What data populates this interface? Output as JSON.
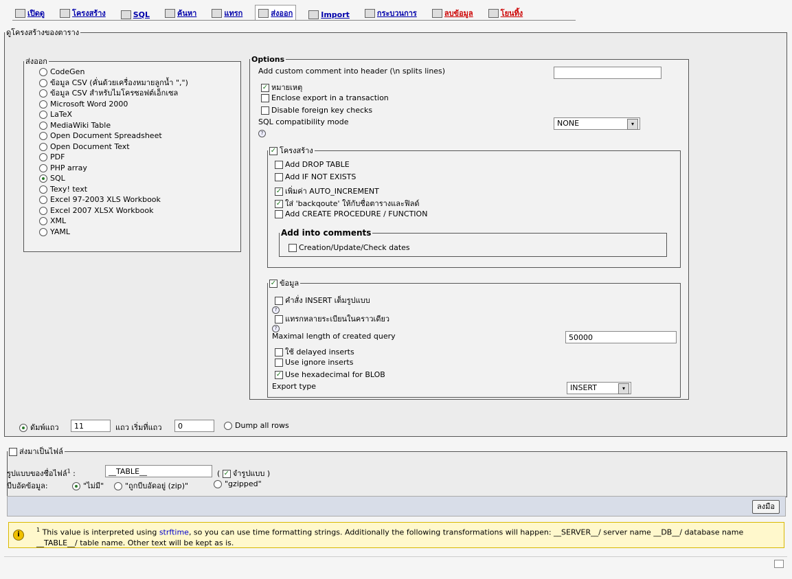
{
  "tabs": [
    {
      "label": "เปิดดู"
    },
    {
      "label": "โครงสร้าง"
    },
    {
      "label": "SQL"
    },
    {
      "label": "ค้นหา"
    },
    {
      "label": "แทรก"
    },
    {
      "label": "ส่งออก",
      "active": true
    },
    {
      "label": "Import"
    },
    {
      "label": "กระบวนการ"
    },
    {
      "label": "ลบข้อมูล",
      "danger": true
    },
    {
      "label": "โยนทิ้ง",
      "danger": true
    }
  ],
  "main_legend": "ดูโครงสร้างของตาราง",
  "export": {
    "legend": "ส่งออก",
    "formats": [
      "CodeGen",
      "ข้อมูล CSV (คั่นด้วยเครื่องหมายลูกน้ำ \",\")",
      "ข้อมูล CSV สำหรับไมโครซอฟต์เอ็กเซล",
      "Microsoft Word 2000",
      "LaTeX",
      "MediaWiki Table",
      "Open Document Spreadsheet",
      "Open Document Text",
      "PDF",
      "PHP array",
      "SQL",
      "Texy! text",
      "Excel 97-2003 XLS Workbook",
      "Excel 2007 XLSX Workbook",
      "XML",
      "YAML"
    ],
    "selected": "SQL"
  },
  "options": {
    "legend": "Options",
    "custom_comment_label": "Add custom comment into header (\\n splits lines)",
    "custom_comment_value": "",
    "remark_label": "หมายเหตุ",
    "transaction_label": "Enclose export in a transaction",
    "fk_label": "Disable foreign key checks",
    "compat_label": "SQL compatibility mode",
    "compat_value": "NONE"
  },
  "structure": {
    "legend": "โครงสร้าง",
    "drop_table": "Add DROP TABLE",
    "if_not_exists": "Add IF NOT EXISTS",
    "auto_increment": "เพิ่มค่า AUTO_INCREMENT",
    "backquote": "ใส่ 'backqoute' ให้กับชื่อตารางและฟิลด์",
    "procedure": "Add CREATE PROCEDURE / FUNCTION",
    "comments_legend": "Add into comments",
    "dates": "Creation/Update/Check dates"
  },
  "data": {
    "legend": "ข้อมูล",
    "full_insert": "คำสั่ง INSERT เต็มรูปแบบ",
    "multi_insert": "แทรกหลายระเบียนในคราวเดียว",
    "max_len_label": "Maximal length of created query",
    "max_len_value": "50000",
    "delayed": "ใช้ delayed inserts",
    "ignore": "Use ignore inserts",
    "hex": "Use hexadecimal for BLOB",
    "export_type_label": "Export type",
    "export_type_value": "INSERT"
  },
  "rows": {
    "dump_label": "ดัมพ์แถว",
    "count": "11",
    "start_label": "แถว เริ่มที่แถว",
    "start": "0",
    "all_label": "Dump all rows"
  },
  "file": {
    "legend": "ส่งมาเป็นไฟล์",
    "name_label": "รูปแบบของชื่อไฟล์",
    "name_sup": "1",
    "name_colon": " :",
    "name_value": "__TABLE__",
    "remember_open": "(",
    "remember_label": "จำรูปแบบ",
    "remember_close": ")",
    "compress_label": "บีบอัดข้อมูล:",
    "none": "\"ไม่มี\"",
    "zip": "\"ถูกบีบอัดอยู่ (zip)\"",
    "gzip": "\"gzipped\""
  },
  "go_button": "ลงมือ",
  "notice": {
    "sup": "1",
    "before": " This value is interpreted using ",
    "link": "strftime",
    "after": ", so you can use time formatting strings. Additionally the following transformations will happen: __SERVER__/ server name __DB__/ database name __TABLE__/ table name. Other text will be kept as is."
  },
  "icons": {
    "help": "?",
    "info": "i",
    "check": "✓",
    "arrow": "▾"
  }
}
